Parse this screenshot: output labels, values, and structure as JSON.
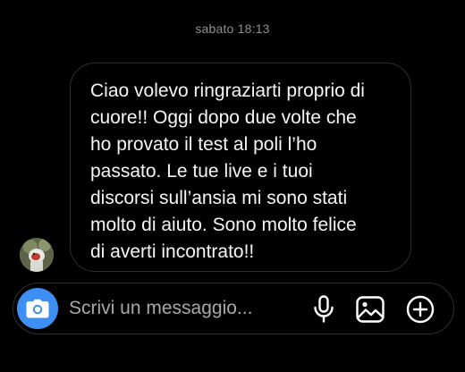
{
  "thread": {
    "timestamp": "sabato 18:13"
  },
  "message": {
    "text": "Ciao volevo ringraziarti proprio di\ncuore!! Oggi dopo due volte che\nho provato il test al poli l’ho\npassato. Le tue live e i tuoi\ndiscorsi sull’ansia mi sono stati\nmolto di aiuto. Sono molto felice\ndi averti incontrato!!",
    "bubble_border_color": "#2e2e2e"
  },
  "composer": {
    "placeholder": "Scrivi un messaggio...",
    "icons": {
      "camera": "camera-icon",
      "mic": "microphone-icon",
      "gallery": "image-icon",
      "plus": "plus-circle-icon"
    },
    "accent_color": "#3d8ff3"
  }
}
